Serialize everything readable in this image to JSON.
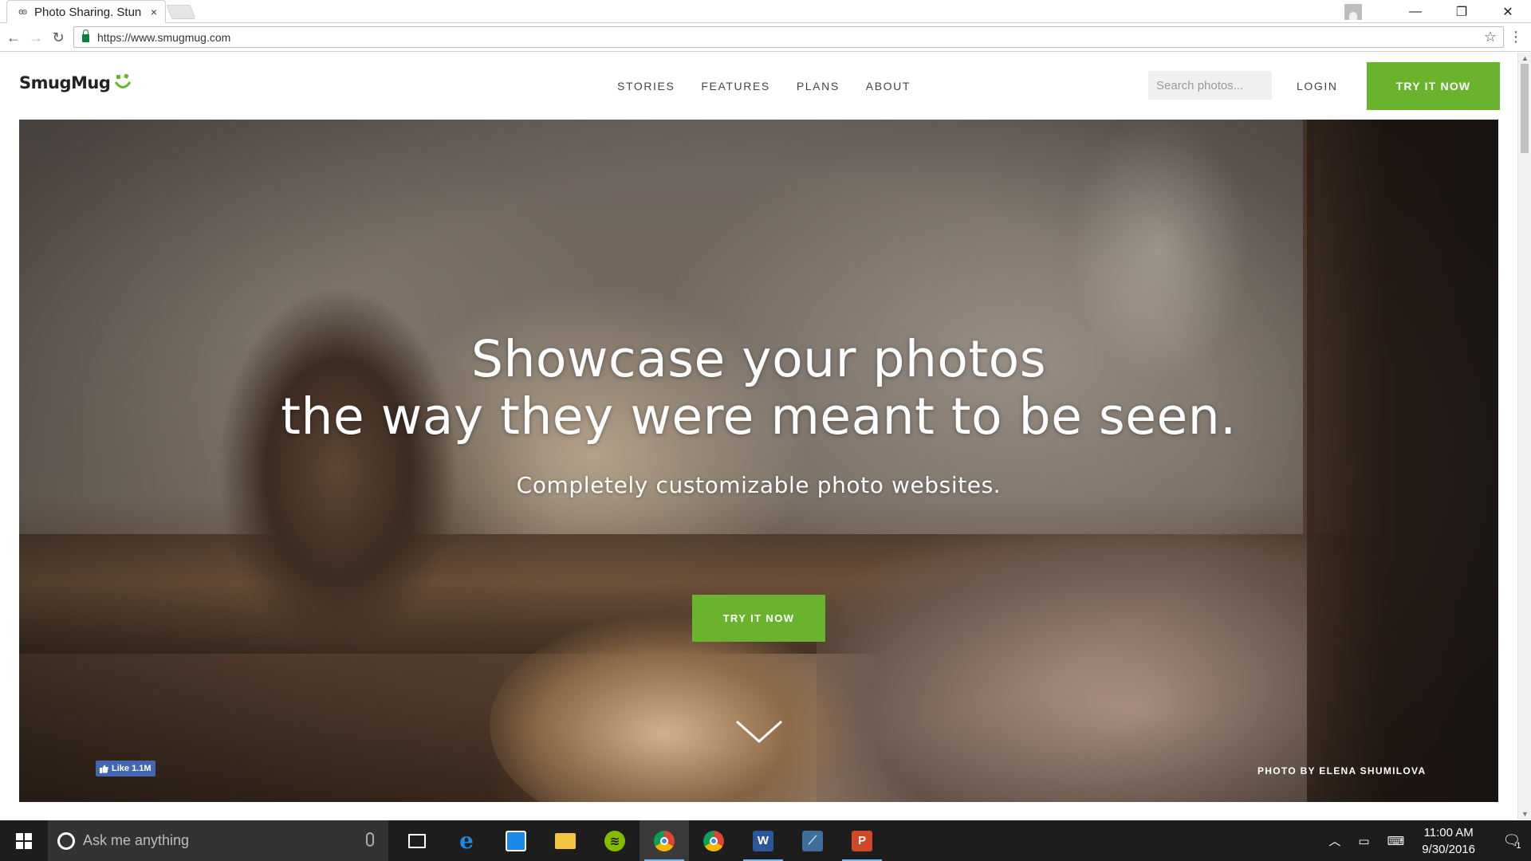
{
  "browser": {
    "tab_title": "Photo Sharing. Stun",
    "tab_close": "×",
    "url": "https://www.smugmug.com",
    "window_controls": {
      "minimize": "—",
      "restore": "❐",
      "close": "✕"
    }
  },
  "site": {
    "logo_text": "SmugMug",
    "nav": [
      "STORIES",
      "FEATURES",
      "PLANS",
      "ABOUT"
    ],
    "search_placeholder": "Search photos...",
    "login": "LOGIN",
    "cta_top": "TRY IT NOW",
    "accent_color": "#6ab42d"
  },
  "hero": {
    "headline_line1": "Showcase your photos",
    "headline_line2": "the way they were meant to be seen.",
    "subheadline": "Completely customizable photo websites.",
    "cta": "TRY IT NOW",
    "fb_like": "Like 1.1M",
    "photo_credit": "PHOTO BY ELENA SHUMILOVA"
  },
  "taskbar": {
    "search_placeholder": "Ask me anything",
    "apps": [
      {
        "name": "task-view",
        "glyph": "▭"
      },
      {
        "name": "edge",
        "glyph": "e"
      },
      {
        "name": "store",
        "glyph": "◘"
      },
      {
        "name": "file-explorer",
        "glyph": "▬"
      },
      {
        "name": "spotify",
        "glyph": "≋"
      },
      {
        "name": "chrome",
        "glyph": "◉"
      },
      {
        "name": "chrome-2",
        "glyph": "◉"
      },
      {
        "name": "word",
        "glyph": "W"
      },
      {
        "name": "remote",
        "glyph": "⟋"
      },
      {
        "name": "powerpoint",
        "glyph": "P"
      }
    ],
    "time": "11:00 AM",
    "date": "9/30/2016",
    "notification_count": "1"
  }
}
